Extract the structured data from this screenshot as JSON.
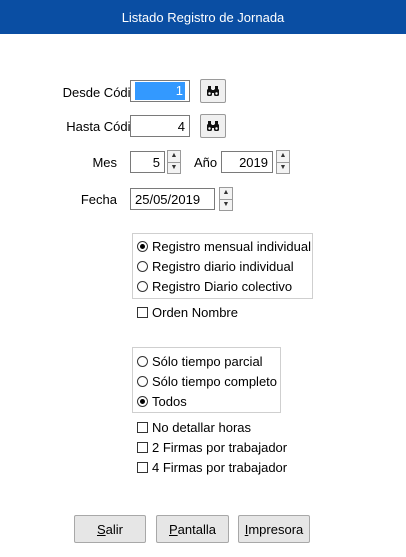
{
  "window": {
    "title": "Listado Registro de Jornada"
  },
  "form": {
    "desde_codigo": {
      "label": "Desde Código",
      "value": "1"
    },
    "hasta_codigo": {
      "label": "Hasta Código",
      "value": "4"
    },
    "mes": {
      "label": "Mes",
      "value": "5"
    },
    "anio": {
      "label": "Año",
      "value": "2019"
    },
    "fecha": {
      "label": "Fecha",
      "value": "25/05/2019"
    }
  },
  "report_type": {
    "options": [
      {
        "label": "Registro mensual individual",
        "selected": true
      },
      {
        "label": "Registro diario individual",
        "selected": false
      },
      {
        "label": "Registro Diario colectivo",
        "selected": false
      }
    ]
  },
  "orden_nombre": {
    "label": "Orden Nombre",
    "checked": false
  },
  "tiempo": {
    "options": [
      {
        "label": "Sólo tiempo parcial",
        "selected": false
      },
      {
        "label": "Sólo tiempo completo",
        "selected": false
      },
      {
        "label": "Todos",
        "selected": true
      }
    ]
  },
  "checks": [
    {
      "label": "No detallar horas",
      "checked": false
    },
    {
      "label": "2 Firmas por trabajador",
      "checked": false
    },
    {
      "label": "4 Firmas por trabajador",
      "checked": false
    }
  ],
  "buttons": {
    "salir": {
      "mnemonic": "S",
      "rest": "alir"
    },
    "pantalla": {
      "mnemonic": "P",
      "rest": "antalla"
    },
    "impresora": {
      "mnemonic": "I",
      "rest": "mpresora"
    }
  }
}
